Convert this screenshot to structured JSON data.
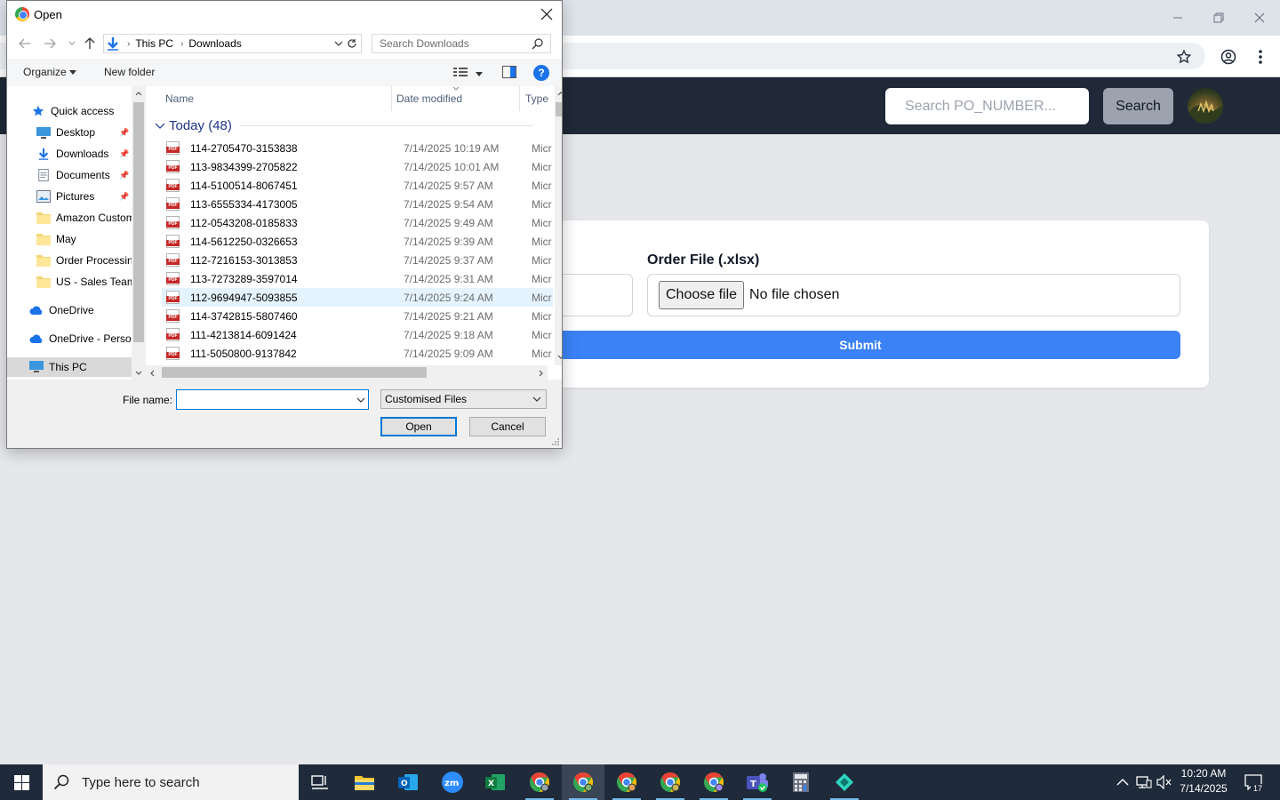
{
  "webpage": {
    "search_placeholder": "Search PO_NUMBER...",
    "search_button": "Search",
    "order_file_label": "Order File (.xlsx)",
    "choose_file_label": "Choose file",
    "no_file_text": "No file chosen",
    "submit_label": "Submit"
  },
  "dialog": {
    "title": "Open",
    "breadcrumb": [
      "This PC",
      "Downloads"
    ],
    "search_placeholder": "Search Downloads",
    "organize_label": "Organize",
    "new_folder_label": "New folder",
    "help_label": "?",
    "nav_pane": [
      {
        "label": "Quick access",
        "icon": "star-icon"
      },
      {
        "label": "Desktop",
        "icon": "desktop-icon",
        "pinned": true
      },
      {
        "label": "Downloads",
        "icon": "download-icon",
        "pinned": true
      },
      {
        "label": "Documents",
        "icon": "document-icon",
        "pinned": true
      },
      {
        "label": "Pictures",
        "icon": "pictures-icon",
        "pinned": true
      },
      {
        "label": "Amazon Custom",
        "icon": "folder-icon"
      },
      {
        "label": "May",
        "icon": "folder-icon"
      },
      {
        "label": "Order Processing",
        "icon": "folder-icon"
      },
      {
        "label": "US - Sales Team",
        "icon": "folder-icon"
      },
      {
        "label": "OneDrive",
        "icon": "cloud-icon"
      },
      {
        "label": "OneDrive - Person",
        "icon": "cloud-icon"
      },
      {
        "label": "This PC",
        "icon": "computer-icon",
        "selected": true
      }
    ],
    "columns": {
      "name": "Name",
      "date": "Date modified",
      "type": "Type"
    },
    "group": "Today (48)",
    "files": [
      {
        "name": "114-2705470-3153838",
        "date": "7/14/2025 10:19 AM",
        "type": "Micr"
      },
      {
        "name": "113-9834399-2705822",
        "date": "7/14/2025 10:01 AM",
        "type": "Micr"
      },
      {
        "name": "114-5100514-8067451",
        "date": "7/14/2025 9:57 AM",
        "type": "Micr"
      },
      {
        "name": "113-6555334-4173005",
        "date": "7/14/2025 9:54 AM",
        "type": "Micr"
      },
      {
        "name": "112-0543208-0185833",
        "date": "7/14/2025 9:49 AM",
        "type": "Micr"
      },
      {
        "name": "114-5612250-0326653",
        "date": "7/14/2025 9:39 AM",
        "type": "Micr"
      },
      {
        "name": "112-7216153-3013853",
        "date": "7/14/2025 9:37 AM",
        "type": "Micr"
      },
      {
        "name": "113-7273289-3597014",
        "date": "7/14/2025 9:31 AM",
        "type": "Micr"
      },
      {
        "name": "112-9694947-5093855",
        "date": "7/14/2025 9:24 AM",
        "type": "Micr"
      },
      {
        "name": "114-3742815-5807460",
        "date": "7/14/2025 9:21 AM",
        "type": "Micr"
      },
      {
        "name": "111-4213814-6091424",
        "date": "7/14/2025 9:18 AM",
        "type": "Micr"
      },
      {
        "name": "111-5050800-9137842",
        "date": "7/14/2025 9:09 AM",
        "type": "Micr"
      }
    ],
    "hovered_file_index": 8,
    "file_name_label": "File name:",
    "file_name_value": "",
    "filter_value": "Customised Files",
    "open_label": "Open",
    "cancel_label": "Cancel"
  },
  "taskbar": {
    "search_text": "Type here to search",
    "time": "10:20 AM",
    "date": "7/14/2025",
    "notification_count": "17"
  },
  "colors": {
    "navbar": "#1f2937",
    "submit": "#3b82f6",
    "taskbar": "#1f2a3a"
  }
}
